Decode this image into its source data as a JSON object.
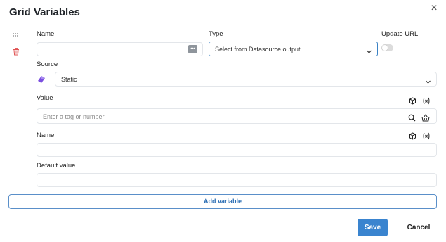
{
  "dialog": {
    "title": "Grid Variables",
    "close_icon": "×"
  },
  "row": {
    "drag_icon": "⋮⋮",
    "delete_icon": "trash-icon",
    "name_label": "Name",
    "name_value": "",
    "name_menu_icon": "•••",
    "type_label": "Type",
    "type_value": "Select from Datasource output",
    "update_url_label": "Update URL",
    "update_url_on": false,
    "source_label": "Source",
    "source_value": "Static",
    "value_label": "Value",
    "value_placeholder": "Enter a tag or number",
    "name2_label": "Name",
    "name2_value": "",
    "default_label": "Default value",
    "default_value": ""
  },
  "actions": {
    "add_label": "Add variable",
    "save_label": "Save",
    "cancel_label": "Cancel"
  },
  "colors": {
    "accent": "#3a84cf",
    "delete": "#e05252",
    "source_icon": "#7b4fe0"
  }
}
